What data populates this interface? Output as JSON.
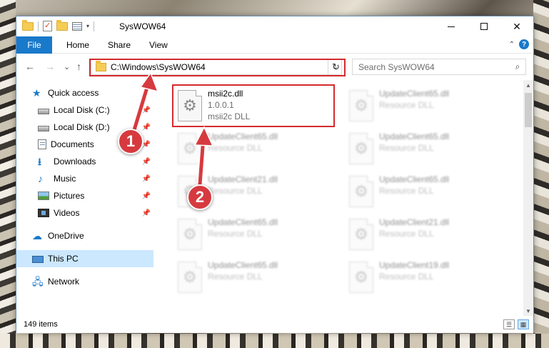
{
  "window": {
    "title": "SysWOW64",
    "minimize": "—",
    "close": "✕"
  },
  "ribbon": {
    "tabs": [
      "File",
      "Home",
      "Share",
      "View"
    ],
    "help": "?",
    "collapse": "⌃"
  },
  "navigation": {
    "back": "←",
    "forward": "→",
    "recent": "⌄",
    "up": "↑",
    "address": "C:\\Windows\\SysWOW64",
    "address_dropdown": "⌄",
    "refresh": "↻",
    "search_placeholder": "Search SysWOW64",
    "search_icon": "⌕"
  },
  "sidebar": {
    "items": [
      {
        "label": "Quick access",
        "icon": "star-icon"
      },
      {
        "label": "Local Disk (C:)",
        "icon": "disk-icon",
        "pinned": true
      },
      {
        "label": "Local Disk (D:)",
        "icon": "disk-icon",
        "pinned": true
      },
      {
        "label": "Documents",
        "icon": "documents-icon",
        "pinned": true
      },
      {
        "label": "Downloads",
        "icon": "download-icon",
        "pinned": true
      },
      {
        "label": "Music",
        "icon": "music-icon",
        "pinned": true
      },
      {
        "label": "Pictures",
        "icon": "pictures-icon",
        "pinned": true
      },
      {
        "label": "Videos",
        "icon": "videos-icon",
        "pinned": true
      },
      {
        "label": "OneDrive",
        "icon": "cloud-icon"
      },
      {
        "label": "This PC",
        "icon": "computer-icon",
        "selected": true
      },
      {
        "label": "Network",
        "icon": "network-icon"
      }
    ],
    "pin_glyph": "📌"
  },
  "files": [
    {
      "name": "msii2c.dll",
      "line1": "1.0.0.1",
      "line2": "msii2c DLL"
    },
    {
      "name": "UpdateClient65.dll",
      "line1": "Resource DLL",
      "line2": ""
    },
    {
      "name": "UpdateClient65.dll",
      "line1": "Resource DLL",
      "line2": ""
    },
    {
      "name": "UpdateClient65.dll",
      "line1": "Resource DLL",
      "line2": ""
    },
    {
      "name": "UpdateClient21.dll",
      "line1": "Resource DLL",
      "line2": ""
    },
    {
      "name": "UpdateClient65.dll",
      "line1": "Resource DLL",
      "line2": ""
    },
    {
      "name": "UpdateClient65.dll",
      "line1": "Resource DLL",
      "line2": ""
    },
    {
      "name": "UpdateClient21.dll",
      "line1": "Resource DLL",
      "line2": ""
    },
    {
      "name": "UpdateClient65.dll",
      "line1": "Resource DLL",
      "line2": ""
    },
    {
      "name": "UpdateClient19.dll",
      "line1": "Resource DLL",
      "line2": ""
    }
  ],
  "status": {
    "item_count": "149 items",
    "details_view": "☰",
    "tiles_view": "▦"
  },
  "annotations": {
    "step1": "1",
    "step2": "2",
    "color": "#d63a3f"
  },
  "scroll": {
    "up": "▲",
    "down": "▼"
  }
}
